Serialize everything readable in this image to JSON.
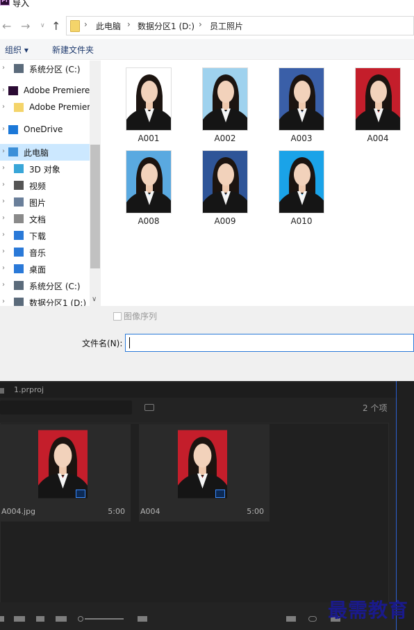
{
  "window": {
    "title": "导入",
    "app_icon_label": "Pr"
  },
  "breadcrumb": [
    "此电脑",
    "数据分区1 (D:)",
    "员工照片"
  ],
  "toolbar": {
    "organize": "组织 ▾",
    "new_folder": "新建文件夹"
  },
  "nav": [
    {
      "label": "系统分区 (C:)",
      "icon": "drive-icon"
    },
    {
      "label": "Adobe Premiere",
      "icon": "premiere-icon"
    },
    {
      "label": "Adobe Premier",
      "icon": "folder-icon"
    },
    {
      "label": "OneDrive",
      "icon": "cloud-icon"
    },
    {
      "label": "此电脑",
      "icon": "computer-icon",
      "selected": true
    },
    {
      "label": "3D 对象",
      "icon": "cube-icon"
    },
    {
      "label": "视频",
      "icon": "video-icon"
    },
    {
      "label": "图片",
      "icon": "picture-icon"
    },
    {
      "label": "文档",
      "icon": "document-icon"
    },
    {
      "label": "下载",
      "icon": "download-icon"
    },
    {
      "label": "音乐",
      "icon": "music-icon"
    },
    {
      "label": "桌面",
      "icon": "desktop-icon"
    },
    {
      "label": "系统分区 (C:)",
      "icon": "drive-icon"
    },
    {
      "label": "数据分区1 (D:)",
      "icon": "drive-icon"
    }
  ],
  "files": [
    {
      "name": "A001",
      "bg": "#ffffff"
    },
    {
      "name": "A002",
      "bg": "#9fd2ee"
    },
    {
      "name": "A003",
      "bg": "#3a5fa8"
    },
    {
      "name": "A004",
      "bg": "#c41e2b"
    },
    {
      "name": "A008",
      "bg": "#5aa9e0"
    },
    {
      "name": "A009",
      "bg": "#2f5598"
    },
    {
      "name": "A010",
      "bg": "#1aa3e8"
    }
  ],
  "options": {
    "image_sequence": "图像序列",
    "filename_label": "文件名(N):",
    "filename_value": ""
  },
  "premiere": {
    "project_tab": "1.prproj",
    "item_count": "2 个项",
    "items": [
      {
        "name": "A004.jpg",
        "duration": "5:00",
        "badge": "image-icon"
      },
      {
        "name": "A004",
        "duration": "5:00",
        "badge": "sequence-icon"
      }
    ]
  },
  "watermark": "最需教育",
  "colors": {
    "accent": "#2a79d8",
    "selection": "#cce8ff",
    "premiere_bg": "#232323"
  }
}
